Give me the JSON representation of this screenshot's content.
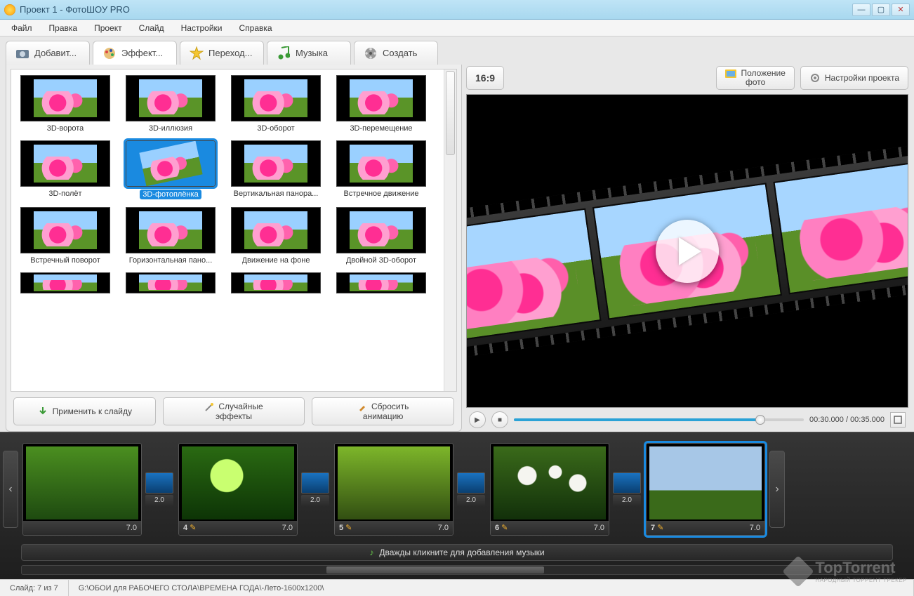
{
  "window": {
    "title": "Проект 1 - ФотоШОУ PRO"
  },
  "menu": [
    "Файл",
    "Правка",
    "Проект",
    "Слайд",
    "Настройки",
    "Справка"
  ],
  "tabs": {
    "add": "Добавит...",
    "fx": "Эффект...",
    "trans": "Переход...",
    "music": "Музыка",
    "create": "Создать"
  },
  "right_buttons": {
    "ratio": "16:9",
    "photo_pos_l1": "Положение",
    "photo_pos_l2": "фото",
    "proj_settings": "Настройки проекта"
  },
  "effects": {
    "row1": [
      "3D-ворота",
      "3D-иллюзия",
      "3D-оборот",
      "3D-перемещение"
    ],
    "row2": [
      "3D-полёт",
      "3D-фотоплёнка",
      "Вертикальная панора...",
      "Встречное движение"
    ],
    "row3": [
      "Встречный поворот",
      "Горизонтальная пано...",
      "Движение на фоне",
      "Двойной 3D-оборот"
    ],
    "selected": "3D-фотоплёнка"
  },
  "fx_actions": {
    "apply": "Применить к слайду",
    "random_l1": "Случайные",
    "random_l2": "эффекты",
    "reset_l1": "Сбросить",
    "reset_l2": "анимацию"
  },
  "playback": {
    "current": "00:30.000",
    "sep": " / ",
    "total": "00:35.000"
  },
  "timeline": {
    "slides": [
      {
        "num": "",
        "dur": "7.0"
      },
      {
        "num": "4",
        "dur": "7.0"
      },
      {
        "num": "5",
        "dur": "7.0"
      },
      {
        "num": "6",
        "dur": "7.0"
      },
      {
        "num": "7",
        "dur": "7.0"
      }
    ],
    "trans_dur": "2.0",
    "music_hint": "Дважды кликните для добавления музыки"
  },
  "status": {
    "slide": "Слайд: 7 из 7",
    "path": "G:\\ОБОИ для РАБОЧЕГО СТОЛА\\ВРЕМЕНА ГОДА\\-Лето-1600x1200\\"
  },
  "watermark": {
    "name": "TopTorrent",
    "sub": "НАРОДНЫЙ ТОРРЕНТ ТРЕКЕР"
  }
}
